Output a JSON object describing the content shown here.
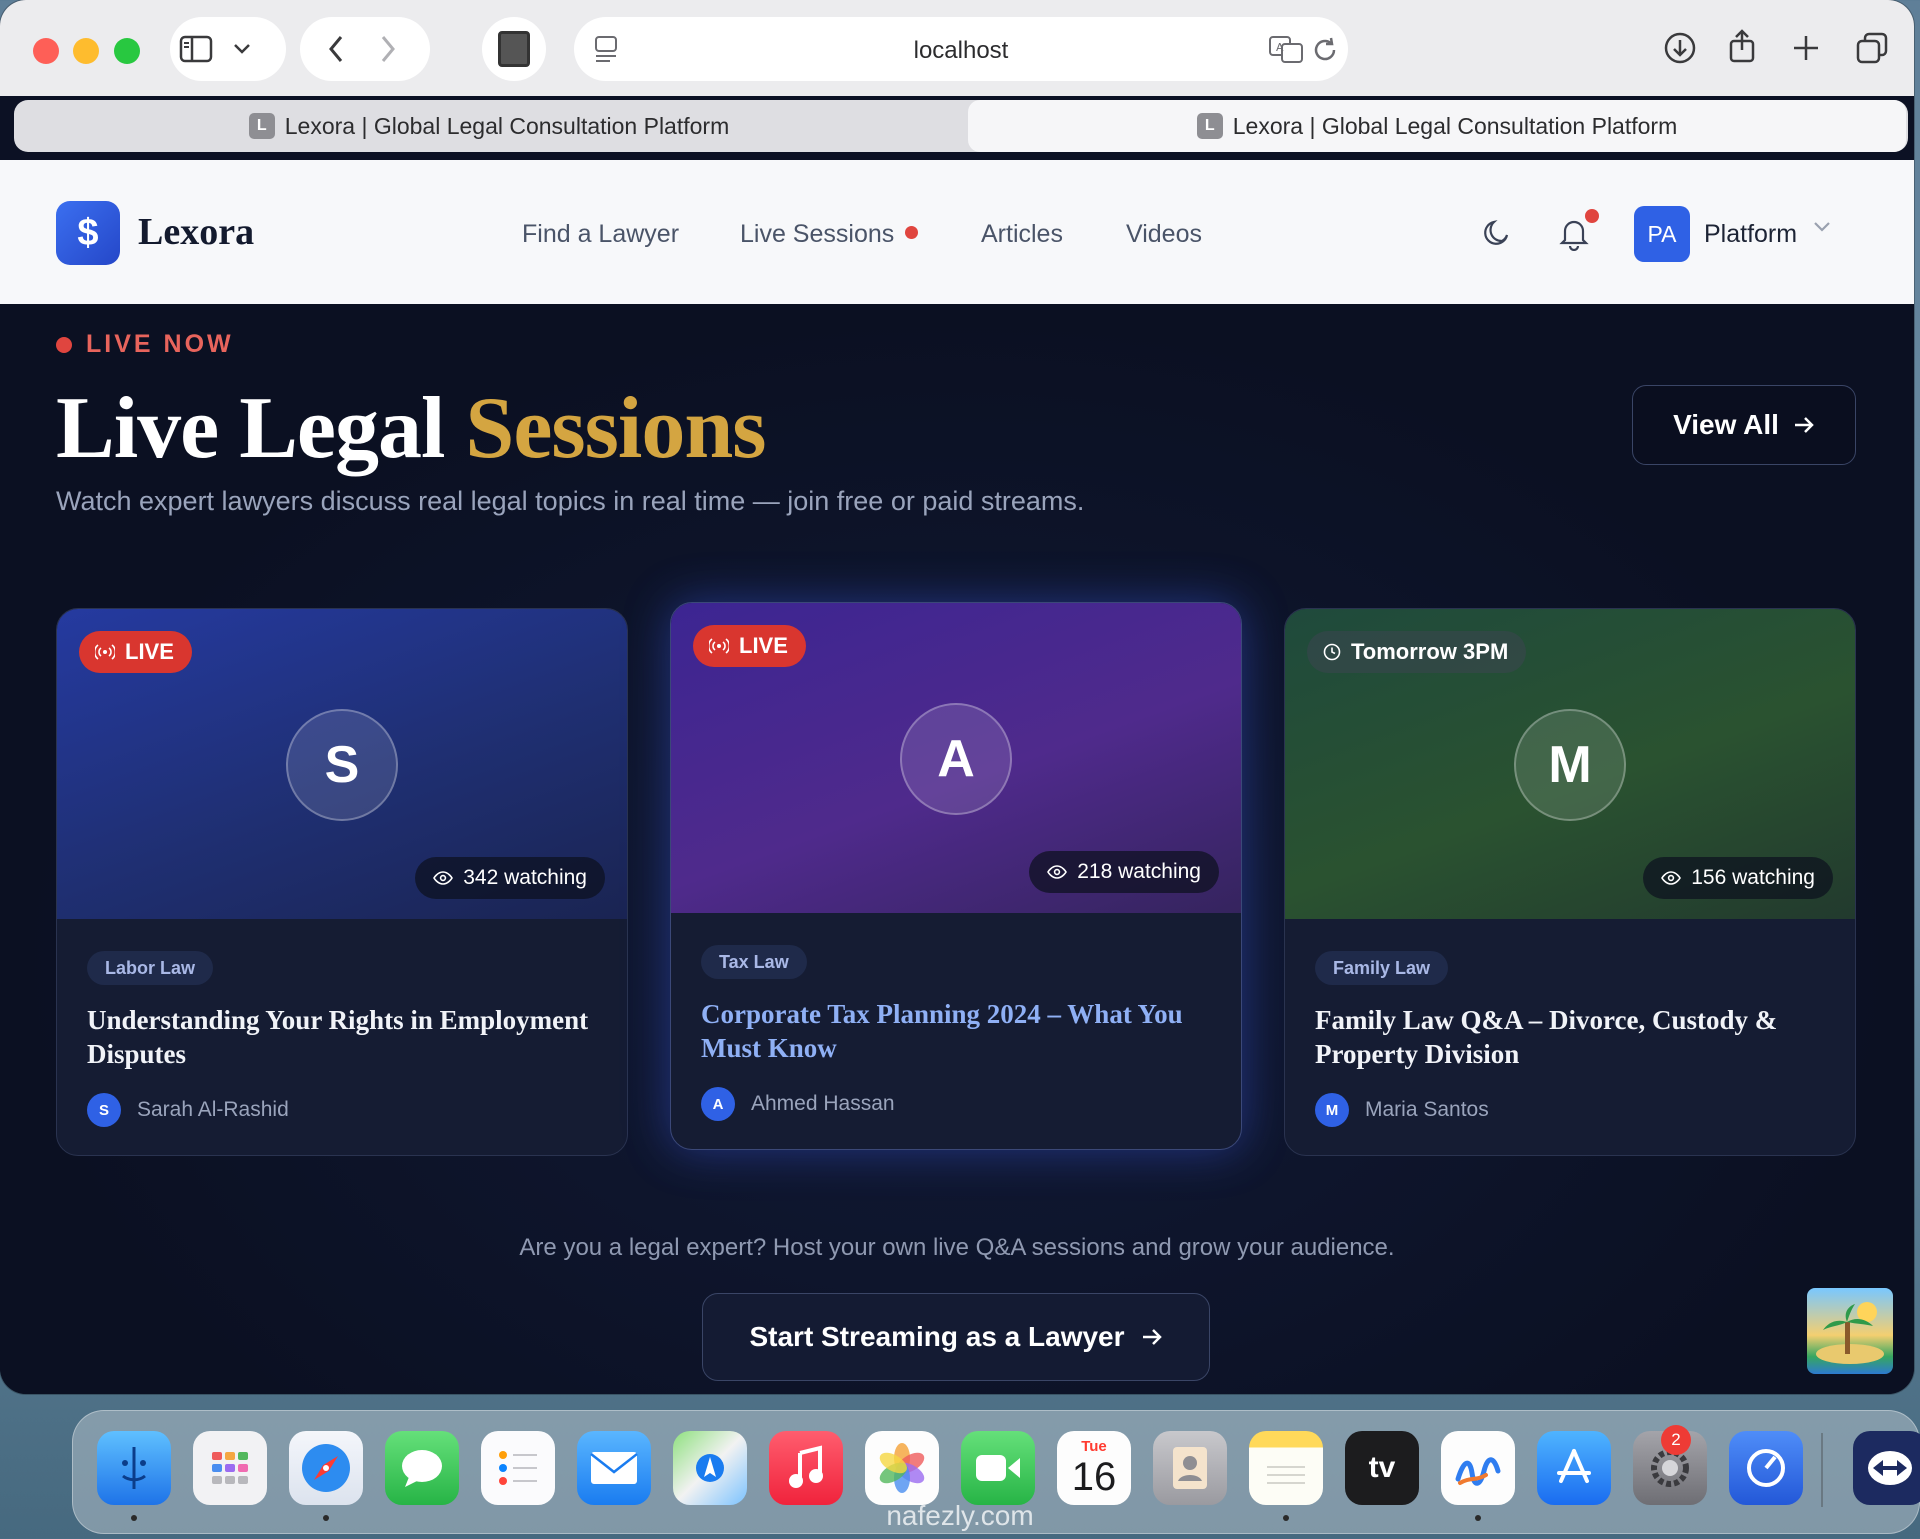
{
  "browser": {
    "address": "localhost",
    "tabs": [
      {
        "label": "Lexora | Global Legal Consultation Platform",
        "favicon": "L",
        "active": false
      },
      {
        "label": "Lexora | Global Legal Consultation Platform",
        "favicon": "L",
        "active": true
      }
    ]
  },
  "header": {
    "logo_mark": "$",
    "logo_text": "Lexora",
    "nav": {
      "find_lawyer": "Find a Lawyer",
      "live_sessions": "Live Sessions",
      "articles": "Articles",
      "videos": "Videos"
    },
    "user_initials": "PA",
    "user_label": "Platform"
  },
  "hero": {
    "eyebrow": "LIVE NOW",
    "title_main": "Live Legal",
    "title_accent": "Sessions",
    "subtitle": "Watch expert lawyers discuss real legal topics in real time — join free or paid streams.",
    "view_all": "View All"
  },
  "sessions": [
    {
      "badge": "LIVE",
      "initial": "S",
      "watching": "342 watching",
      "tag": "Labor Law",
      "title": "Understanding Your Rights in Employment Disputes",
      "author_initial": "S",
      "author": "Sarah Al-Rashid"
    },
    {
      "badge": "LIVE",
      "initial": "A",
      "watching": "218 watching",
      "tag": "Tax Law",
      "title": "Corporate Tax Planning 2024 – What You Must Know",
      "author_initial": "A",
      "author": "Ahmed Hassan"
    },
    {
      "badge": "Tomorrow 3PM",
      "initial": "M",
      "watching": "156 watching",
      "tag": "Family Law",
      "title": "Family Law Q&A – Divorce, Custody & Property Division",
      "author_initial": "M",
      "author": "Maria Santos"
    }
  ],
  "cta": {
    "text": "Are you a legal expert? Host your own live Q&A sessions and grow your audience.",
    "button": "Start Streaming as a Lawyer"
  },
  "dock": {
    "calendar_day": "Tue",
    "calendar_date": "16",
    "settings_badge": "2",
    "tv_label": "tv"
  },
  "watermark": "nafezly.com",
  "colors": {
    "accent_gold": "#d4a541",
    "live_red": "#d9362f",
    "brand_blue": "#2f61e5",
    "page_bg": "#0c1124"
  }
}
